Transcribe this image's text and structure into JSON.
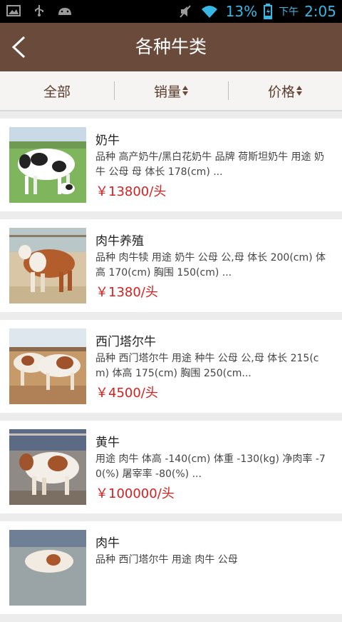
{
  "status": {
    "battery": "13%",
    "time_period": "下午",
    "time": "2:05"
  },
  "header": {
    "title": "各种牛类"
  },
  "filters": [
    {
      "label": "全部"
    },
    {
      "label": "销量"
    },
    {
      "label": "价格"
    }
  ],
  "items": [
    {
      "name": "奶牛",
      "desc": "品种 高产奶牛/黑白花奶牛 品牌 荷斯坦奶牛 用途 奶牛 公母 母 体长 178(cm) ...",
      "price": "￥13800/头"
    },
    {
      "name": "肉牛养殖",
      "desc": "品种 肉牛犊 用途 奶牛 公母 公,母 体长 200(cm) 体高 170(cm) 胸围 150(cm) ...",
      "price": "￥1380/头"
    },
    {
      "name": "西门塔尔牛",
      "desc": "品种 西门塔尔牛 用途 种牛 公母 公,母 体长 215(cm) 体高 175(cm) 胸围 250(cm...",
      "price": "￥4500/头"
    },
    {
      "name": "黄牛",
      "desc": "用途 肉牛 体高 -140(cm) 体重 -130(kg) 净肉率 -70(%) 屠宰率 -80(%) ...",
      "price": "￥100000/头"
    },
    {
      "name": "肉牛",
      "desc": "品种 西门塔尔牛 用途 肉牛 公母",
      "price": ""
    }
  ]
}
